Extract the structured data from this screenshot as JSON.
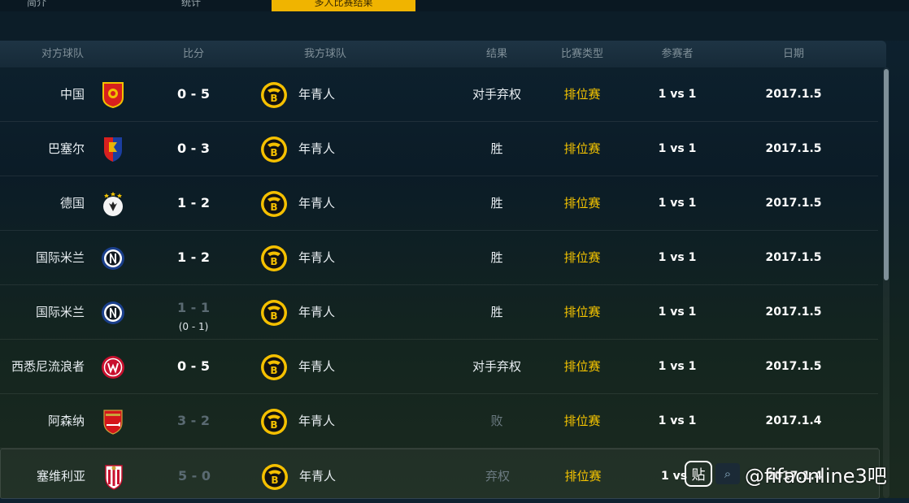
{
  "tabs": [
    {
      "label": "简介"
    },
    {
      "label": "统计"
    },
    {
      "label": "多人比赛结果"
    }
  ],
  "headers": {
    "opponent": "对方球队",
    "score": "比分",
    "my_team": "我方球队",
    "result": "结果",
    "match_type": "比赛类型",
    "participants": "参赛者",
    "date": "日期"
  },
  "rows": [
    {
      "opponent": "中国",
      "opponent_crest": "china-crest-icon",
      "score": "0 - 5",
      "subscore": "",
      "my_team": "年青人",
      "result": "对手弃权",
      "match_type": "排位赛",
      "participants": "1 vs 1",
      "date": "2017.1.5"
    },
    {
      "opponent": "巴塞尔",
      "opponent_crest": "basel-crest-icon",
      "score": "0 - 3",
      "subscore": "",
      "my_team": "年青人",
      "result": "胜",
      "match_type": "排位赛",
      "participants": "1 vs 1",
      "date": "2017.1.5"
    },
    {
      "opponent": "德国",
      "opponent_crest": "germany-crest-icon",
      "score": "1 - 2",
      "subscore": "",
      "my_team": "年青人",
      "result": "胜",
      "match_type": "排位赛",
      "participants": "1 vs 1",
      "date": "2017.1.5"
    },
    {
      "opponent": "国际米兰",
      "opponent_crest": "inter-crest-icon",
      "score": "1 - 2",
      "subscore": "",
      "my_team": "年青人",
      "result": "胜",
      "match_type": "排位赛",
      "participants": "1 vs 1",
      "date": "2017.1.5"
    },
    {
      "opponent": "国际米兰",
      "opponent_crest": "inter-crest-icon",
      "score": "1 - 1",
      "subscore": "(0 - 1)",
      "my_team": "年青人",
      "result": "胜",
      "match_type": "排位赛",
      "participants": "1 vs 1",
      "date": "2017.1.5"
    },
    {
      "opponent": "西悉尼流浪者",
      "opponent_crest": "wanderers-crest-icon",
      "score": "0 - 5",
      "subscore": "",
      "my_team": "年青人",
      "result": "对手弃权",
      "match_type": "排位赛",
      "participants": "1 vs 1",
      "date": "2017.1.5"
    },
    {
      "opponent": "阿森纳",
      "opponent_crest": "arsenal-crest-icon",
      "score": "3 - 2",
      "subscore": "",
      "my_team": "年青人",
      "result": "败",
      "match_type": "排位赛",
      "participants": "1 vs 1",
      "date": "2017.1.4"
    },
    {
      "opponent": "塞维利亚",
      "opponent_crest": "sevilla-crest-icon",
      "score": "5 - 0",
      "subscore": "",
      "my_team": "年青人",
      "result": "弃权",
      "match_type": "排位赛",
      "participants": "1 vs",
      "date": "2017.1.4"
    }
  ],
  "my_team_crest": "young-boys-crest-icon",
  "colors": {
    "accent": "#f0b400",
    "match_type": "#f5c400"
  },
  "watermark": {
    "box_text": "贴",
    "text": "@fifaonline3吧"
  }
}
